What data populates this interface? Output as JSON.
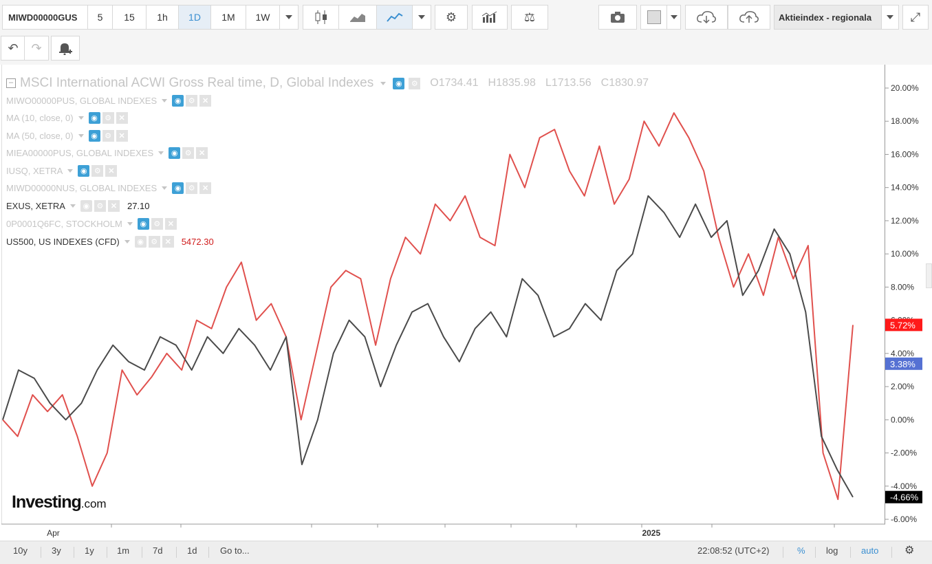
{
  "toolbar": {
    "symbol": "MIWD00000GUS",
    "intervals": [
      "5",
      "15",
      "1h",
      "1D",
      "1M",
      "1W"
    ],
    "active_interval": "1D",
    "indicator_dropdown": "Aktieindex - regionala"
  },
  "legend": {
    "title": "MSCI International ACWI Gross Real time, D, Global Indexes",
    "ohlc": {
      "open": "O1734.41",
      "high": "H1835.98",
      "low": "L1713.56",
      "close": "C1830.97"
    },
    "rows": [
      {
        "label": "MIWO00000PUS, GLOBAL INDEXES",
        "value": ""
      },
      {
        "label": "MA (10, close, 0)",
        "value": ""
      },
      {
        "label": "MA (50, close, 0)",
        "value": ""
      },
      {
        "label": "MIEA00000PUS, GLOBAL INDEXES",
        "value": ""
      },
      {
        "label": "IUSQ, XETRA",
        "value": ""
      },
      {
        "label": "MIWD00000NUS, GLOBAL INDEXES",
        "value": ""
      },
      {
        "label": "EXUS, XETRA",
        "value": "27.10"
      },
      {
        "label": "0P0001Q6FC, STOCKHOLM",
        "value": ""
      },
      {
        "label": "US500, US INDEXES (CFD)",
        "value": "5472.30"
      }
    ]
  },
  "colors": {
    "us500": "#e0504d",
    "exus": "#4a4a4a",
    "active": "#3a8fd1"
  },
  "watermark": {
    "brand": "Investing",
    "suffix": ".com"
  },
  "price_badges": [
    {
      "text": "5.72%",
      "color": "#ff1a1a",
      "value": 5.72
    },
    {
      "text": "3.38%",
      "color": "#5571d3",
      "value": 3.38
    },
    {
      "text": "-4.66%",
      "color": "#000000",
      "value": -4.66
    }
  ],
  "bottom_bar": {
    "ranges": [
      "10y",
      "3y",
      "1y",
      "1m",
      "7d",
      "1d"
    ],
    "goto": "Go to...",
    "clock": "22:08:52 (UTC+2)",
    "percent": "%",
    "log": "log",
    "auto": "auto"
  },
  "chart_data": {
    "type": "line",
    "y_unit": "%",
    "ylim": [
      -6,
      20
    ],
    "y_ticks": [
      20,
      18,
      16,
      14,
      12,
      10,
      8,
      6,
      4,
      2,
      0,
      -2,
      -4,
      -6
    ],
    "y_tick_labels": [
      "20.00%",
      "18.00%",
      "16.00%",
      "14.00%",
      "12.00%",
      "10.00%",
      "8.00%",
      "6.00%",
      "4.00%",
      "2.00%",
      "0.00%",
      "-2.00%",
      "-4.00%",
      "-6.00%"
    ],
    "x_labels": [
      {
        "label": "Apr",
        "t": 0.05
      },
      {
        "label": "2025",
        "t": 0.725
      }
    ],
    "series": [
      {
        "name": "US500, US INDEXES (CFD)",
        "color": "#e0504d",
        "values": [
          0,
          -1,
          1.5,
          0.5,
          1.5,
          -1,
          -4,
          -2,
          3,
          1.5,
          2.6,
          4,
          3,
          6,
          5.5,
          8,
          9.5,
          6,
          7,
          5,
          0,
          4,
          8,
          9,
          8.5,
          4.5,
          8.5,
          11,
          10,
          13,
          12,
          13.5,
          11,
          10.5,
          16,
          14,
          17,
          17.5,
          15,
          13.5,
          16.5,
          13,
          14.5,
          18,
          16.5,
          18.5,
          17,
          15,
          11,
          8,
          10,
          7.5,
          11,
          8.5,
          10.5,
          -2,
          -4.8,
          5.72
        ]
      },
      {
        "name": "EXUS, XETRA",
        "color": "#4a4a4a",
        "values": [
          0,
          3,
          2.5,
          1,
          0,
          1,
          3,
          4.5,
          3.5,
          3,
          5,
          4.5,
          3,
          5,
          4,
          5.5,
          4.5,
          3,
          5,
          -2.7,
          0,
          4,
          6,
          5,
          2,
          4.5,
          6.5,
          7,
          5,
          3.5,
          5.5,
          6.5,
          5,
          8.5,
          7.5,
          5,
          5.5,
          7,
          6,
          9,
          10,
          13.5,
          12.5,
          11,
          13,
          11,
          12,
          7.5,
          9,
          11.5,
          10,
          6.5,
          -1,
          -3,
          -4.66
        ]
      }
    ]
  }
}
